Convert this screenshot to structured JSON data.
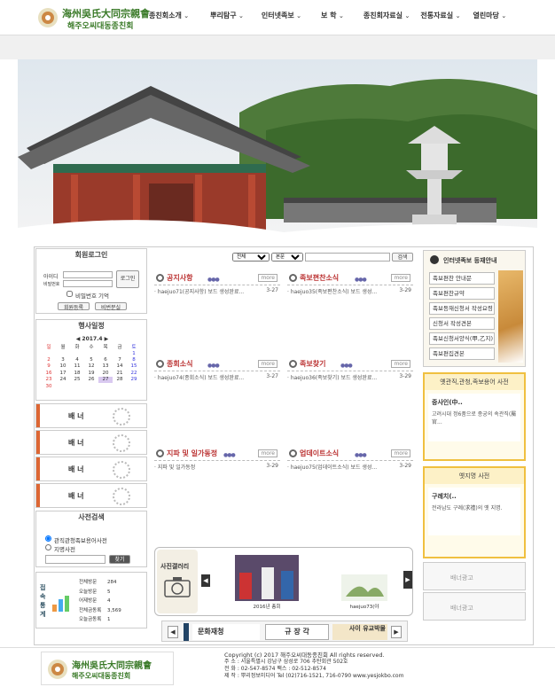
{
  "header": {
    "title1": "海州吳氏大同宗親會",
    "title2": "해주오씨대동종친회"
  },
  "nav": [
    "종친회소개",
    "뿌리탐구",
    "인터넷족보",
    "보  학",
    "종친회자료실",
    "전통자료실",
    "열린마당"
  ],
  "login": {
    "title": "회원로그인",
    "id_label": "아이디",
    "pw_label": "비밀번호",
    "login_btn": "로그인",
    "remember": "비밀번호 기억",
    "join": "회원등록",
    "find": "비번분실"
  },
  "schedule": {
    "title": "행사일정",
    "month": "2017.4",
    "days": [
      "일",
      "월",
      "화",
      "수",
      "목",
      "금",
      "토"
    ],
    "weeks": [
      [
        "",
        "",
        "",
        "",
        "",
        "",
        "1"
      ],
      [
        "2",
        "3",
        "4",
        "5",
        "6",
        "7",
        "8"
      ],
      [
        "9",
        "10",
        "11",
        "12",
        "13",
        "14",
        "15"
      ],
      [
        "16",
        "17",
        "18",
        "19",
        "20",
        "21",
        "22"
      ],
      [
        "23",
        "24",
        "25",
        "26",
        "27",
        "28",
        "29"
      ],
      [
        "30",
        "",
        "",
        "",
        "",
        "",
        ""
      ]
    ]
  },
  "banners": [
    "배 너",
    "배 너",
    "배 너",
    "배 너"
  ],
  "dictsearch": {
    "title": "사전검색",
    "opt1": "관직관청족보용어사전",
    "opt2": "지명사전",
    "btn": "찾기"
  },
  "stats": {
    "label": "접속통계",
    "rows": [
      {
        "k": "전체방문",
        "v": "284"
      },
      {
        "k": "오늘방문",
        "v": "5"
      },
      {
        "k": "어제방문",
        "v": "4"
      },
      {
        "k": "전체금동록",
        "v": "3,569"
      },
      {
        "k": "오늘금동록",
        "v": "1"
      }
    ]
  },
  "search": {
    "sel1": "전체",
    "sel2": "본문",
    "btn": "검색"
  },
  "boards": [
    {
      "title": "공지사항",
      "item": "haejuo71(공지사항) 보드 생성완료...",
      "date": "3-27",
      "more": "more"
    },
    {
      "title": "족보편찬소식",
      "item": "haejuo35(족보편찬소식) 보드 생성...",
      "date": "3-29",
      "more": "more"
    },
    {
      "title": "종회소식",
      "item": "haejuo74(종회소식) 보드 생성완료...",
      "date": "3-27",
      "more": "more"
    },
    {
      "title": "족보찾기",
      "item": "haejuo36(족보찾기) 보드 생성완료...",
      "date": "3-29",
      "more": "more"
    },
    {
      "title": "지파 및 일가동정",
      "item": "지파 및 일가동정",
      "date": "3-29",
      "more": "more"
    },
    {
      "title": "업데이트소식",
      "item": "haejuo75(업데이트소식) 보드 생성...",
      "date": "3-29",
      "more": "more"
    }
  ],
  "genealogy": {
    "title": "인터넷족보 등재안내",
    "links": [
      "족보편찬 안내문",
      "족보편찬규약",
      "족보등재신청서 작성요령",
      "신청서 작성견본",
      "족보신청서양식(甲,乙지)",
      "족보편집견본"
    ]
  },
  "dict1": {
    "title": "옛관직,관청,족보용어 사전",
    "word": "중사인(中..",
    "desc": "고려시대 정6품으로 종궁의 속관직(屬官..."
  },
  "dict2": {
    "title": "옛지명 사전",
    "word": "구례치(..",
    "desc": "전라남도 구례(求禮)의 옛 지명."
  },
  "rbanners": [
    "배너광고",
    "배너광고"
  ],
  "gallery": {
    "title": "사진갤러리",
    "cap1": "2016년 총회",
    "cap2": "haejuo73(야"
  },
  "logos": [
    "문화재청",
    "규 장 각",
    "사이 유교박물"
  ],
  "footer": {
    "title1": "海州吳氏大同宗親會",
    "title2": "해주오씨대동종친회",
    "copy": "Copyright (c) 2017 해주오씨대동종친회 All rights reserved.",
    "addr": "주   소 : 서울특별시 강남구 삼성로 706 추탄회관 502호",
    "tel": "전   화 : 02-547-8574  팩스 : 02-512-8574",
    "made": "제   작 : 뿌리정보미디어 Tel (02)716-1521, 716-0790 www.yesjokbo.com"
  }
}
